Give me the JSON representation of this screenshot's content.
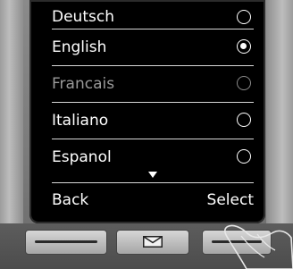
{
  "menu": {
    "items": [
      {
        "label": "Deutsch",
        "selected": false,
        "dim": false
      },
      {
        "label": "English",
        "selected": true,
        "dim": false
      },
      {
        "label": "Francais",
        "selected": false,
        "dim": true
      },
      {
        "label": "Italiano",
        "selected": false,
        "dim": false
      },
      {
        "label": "Espanol",
        "selected": false,
        "dim": false
      }
    ]
  },
  "softkeys": {
    "left": "Back",
    "right": "Select"
  },
  "icons": {
    "scroll_indicator": "scroll-down-arrow-icon",
    "message_key": "envelope-icon",
    "radio_on": "radio-selected-icon",
    "radio_off": "radio-unselected-icon"
  },
  "colors": {
    "screen_bg": "#000000",
    "text": "#ffffff",
    "dim_text": "#9a9a9a"
  }
}
